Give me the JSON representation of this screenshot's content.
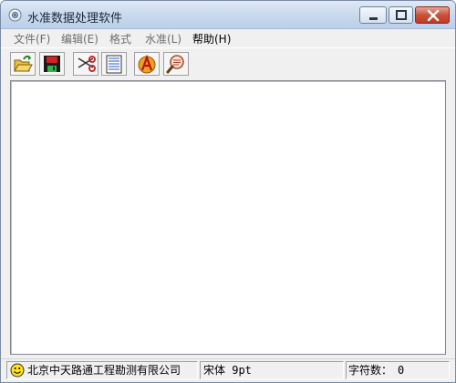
{
  "window": {
    "title": "水准数据处理软件"
  },
  "menu": {
    "items": [
      {
        "label": "文件(F)"
      },
      {
        "label": "编辑(E)"
      },
      {
        "label": "格式"
      },
      {
        "label": "水准(L)"
      },
      {
        "label": "帮助(H)"
      }
    ]
  },
  "toolbar": {
    "buttons": [
      {
        "icon": "open-folder-icon"
      },
      {
        "icon": "save-disk-icon"
      },
      {
        "icon": "cut-scissors-icon"
      },
      {
        "icon": "notepad-icon"
      },
      {
        "icon": "font-a-icon"
      },
      {
        "icon": "preview-magnifier-icon"
      }
    ]
  },
  "editor": {
    "content": ""
  },
  "status": {
    "company": "北京中天路通工程勘测有限公司",
    "font": "宋体 9pt",
    "char_count_label": "字符数：",
    "char_count_value": "0"
  },
  "colors": {
    "titlebar": "#c9d9ee",
    "close_button": "#c43a22",
    "window_bg": "#f0f0f0"
  }
}
